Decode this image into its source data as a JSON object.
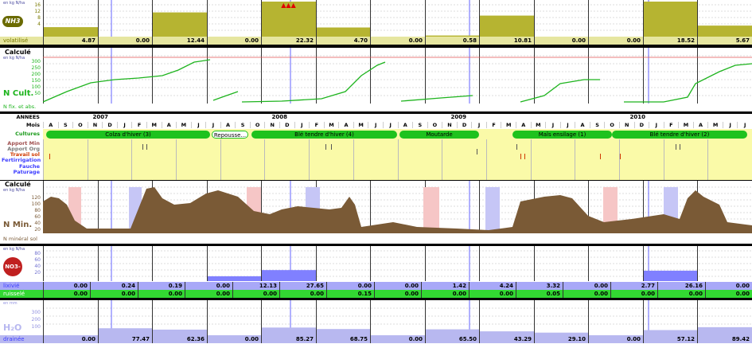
{
  "nh3": {
    "unit": "en kg N/ha",
    "icon_label": "NH3",
    "row_label": "volatilisé",
    "ticks": [
      "16",
      "12",
      "8",
      "4"
    ],
    "values": [
      "4.87",
      "0.00",
      "12.44",
      "0.00",
      "22.32",
      "4.70",
      "0.00",
      "0.58",
      "10.81",
      "0.00",
      "0.00",
      "18.52",
      "5.67"
    ],
    "bar_levels": [
      4.87,
      0,
      12.44,
      0,
      22.32,
      4.7,
      0,
      0.58,
      10.81,
      0,
      0,
      18.52,
      5.67
    ],
    "bar_color": "#b6b431",
    "overflow_marks": "▲▲▲"
  },
  "ncult": {
    "title": "Calculé",
    "unit": "en kg N/ha",
    "ticks": [
      "300",
      "250",
      "200",
      "150",
      "100",
      "50"
    ],
    "big_label": "N Cult.",
    "row_label": "N fix. et abs.",
    "color": "#1eb41e"
  },
  "calendar": {
    "labels": [
      "ANNEES",
      "Mois",
      "Cultures",
      "Apport Min",
      "Apport Org",
      "Travail sol",
      "Fertirrigation",
      "Fauche",
      "Paturage"
    ],
    "label_colors": [
      "#000",
      "#000",
      "#1a9a1a",
      "#a05050",
      "#7a7a7a",
      "#d03a00",
      "#3c3cff",
      "#3c3cff",
      "#3c3cff"
    ],
    "years": [
      "2007",
      "2008",
      "2009",
      "2010"
    ],
    "months": [
      "A",
      "S",
      "O",
      "N",
      "D",
      "J",
      "F",
      "M",
      "A",
      "M",
      "J",
      "J",
      "A",
      "S",
      "O",
      "N",
      "D",
      "J",
      "F",
      "M",
      "A",
      "M",
      "J",
      "J",
      "A",
      "S",
      "O",
      "N",
      "D",
      "J",
      "F",
      "M",
      "A",
      "M",
      "J",
      "J",
      "A",
      "S",
      "O",
      "N",
      "D",
      "J",
      "F",
      "M",
      "A",
      "M",
      "J",
      "J"
    ],
    "crops": [
      "Colza d'hiver (3)",
      "Repousse...",
      "Blé tendre d'hiver (4)",
      "Moutarde",
      "Maïs ensilage (1)",
      "Blé tendre d'hiver (2)"
    ]
  },
  "nmin": {
    "title": "Calculé",
    "unit": "en kg N/ha",
    "ticks": [
      "120",
      "100",
      "80",
      "60",
      "40",
      "20"
    ],
    "big_label": "N Min.",
    "row_label": "N minéral sol",
    "fill": "#7a5a36"
  },
  "no3": {
    "unit": "en kg N/ha",
    "icon_label": "NO3-",
    "ticks": [
      "80",
      "60",
      "40",
      "20"
    ],
    "lixi_label": "lixivié",
    "ruis_label": "ruisselé",
    "lixi": [
      "0.00",
      "0.24",
      "0.19",
      "0.00",
      "12.13",
      "27.65",
      "0.00",
      "0.00",
      "1.42",
      "4.24",
      "3.32",
      "0.00",
      "2.77",
      "26.16",
      "0.00"
    ],
    "ruis": [
      "0.00",
      "0.00",
      "0.00",
      "0.00",
      "0.00",
      "0.00",
      "0.15",
      "0.00",
      "0.00",
      "0.00",
      "0.05",
      "0.00",
      "0.00",
      "0.00",
      "0.00"
    ],
    "bar_color": "#8080ff"
  },
  "h2o": {
    "unit": "en mm",
    "big_label": "H₂O",
    "row_label": "drainée",
    "ticks": [
      "300",
      "200",
      "100"
    ],
    "values": [
      "0.00",
      "77.47",
      "62.36",
      "0.00",
      "85.27",
      "68.75",
      "0.00",
      "65.50",
      "43.29",
      "29.10",
      "0.00",
      "57.12",
      "89.42"
    ],
    "bar_color": "#b8b8f0"
  }
}
